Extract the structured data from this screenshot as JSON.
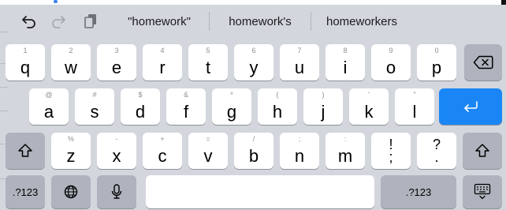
{
  "suggestions": [
    "\"homework\"",
    "homework's",
    "homeworkers"
  ],
  "toolbar": {
    "icons": [
      "undo-icon",
      "redo-icon",
      "paste-icon"
    ]
  },
  "rows": {
    "row1": [
      {
        "alt": "1",
        "main": "q"
      },
      {
        "alt": "2",
        "main": "w"
      },
      {
        "alt": "3",
        "main": "e"
      },
      {
        "alt": "4",
        "main": "r"
      },
      {
        "alt": "5",
        "main": "t"
      },
      {
        "alt": "6",
        "main": "y"
      },
      {
        "alt": "7",
        "main": "u"
      },
      {
        "alt": "8",
        "main": "i"
      },
      {
        "alt": "9",
        "main": "o"
      },
      {
        "alt": "0",
        "main": "p"
      }
    ],
    "row2": [
      {
        "alt": "@",
        "main": "a"
      },
      {
        "alt": "#",
        "main": "s"
      },
      {
        "alt": "$",
        "main": "d"
      },
      {
        "alt": "&",
        "main": "f"
      },
      {
        "alt": "*",
        "main": "g"
      },
      {
        "alt": "(",
        "main": "h"
      },
      {
        "alt": ")",
        "main": "j"
      },
      {
        "alt": "'",
        "main": "k"
      },
      {
        "alt": "\"",
        "main": "l"
      }
    ],
    "row3": [
      {
        "alt": "%",
        "main": "z"
      },
      {
        "alt": "-",
        "main": "x"
      },
      {
        "alt": "+",
        "main": "c"
      },
      {
        "alt": "=",
        "main": "v"
      },
      {
        "alt": "/",
        "main": "b"
      },
      {
        "alt": ";",
        "main": "n"
      },
      {
        "alt": ":",
        "main": "m"
      }
    ],
    "punct": [
      {
        "top": "!",
        "bottom": ";"
      },
      {
        "top": "?",
        "bottom": "."
      }
    ]
  },
  "bottom": {
    "numbers_label": ".?123",
    "numbers_label_right": ".?123"
  },
  "colors": {
    "keyboard_bg": "#d3d6dd",
    "key_bg": "#ffffff",
    "function_key_bg": "#aeb3bd",
    "return_key_bg": "#1a86f5"
  }
}
